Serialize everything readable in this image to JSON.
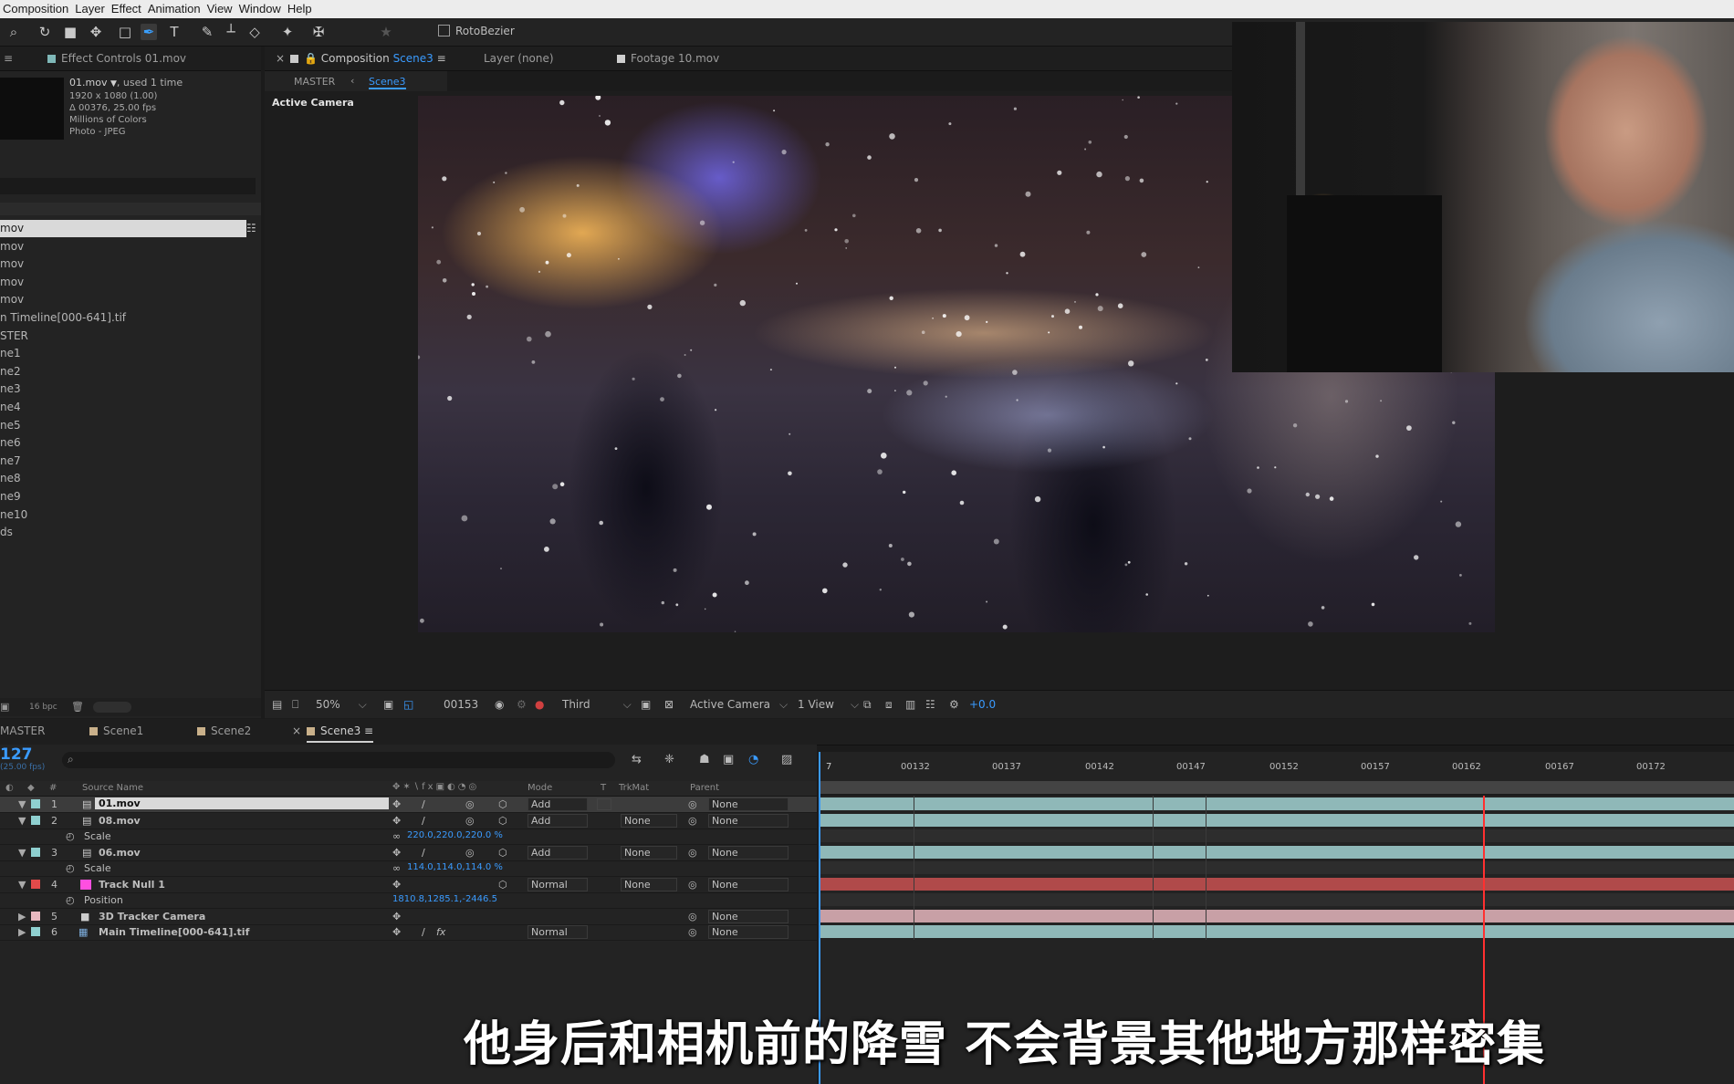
{
  "menu": [
    "Composition",
    "Layer",
    "Effect",
    "Animation",
    "View",
    "Window",
    "Help"
  ],
  "toolbar": {
    "rotobezier": "RotoBezier"
  },
  "effect_controls": {
    "tab": "Effect Controls 01.mov",
    "file_name": "01.mov",
    "used": ", used 1 time",
    "info": [
      "1920 x 1080 (1.00)",
      "Δ 00376, 25.00 fps",
      "Millions of Colors",
      "Photo - JPEG"
    ]
  },
  "project_items": [
    "mov",
    "mov",
    "mov",
    "mov",
    "mov",
    "n Timeline[000-641].tif",
    "STER",
    "ne1",
    "ne2",
    "ne3",
    "ne4",
    "ne5",
    "ne6",
    "ne7",
    "ne8",
    "ne9",
    "ne10",
    "ds"
  ],
  "project_footer": {
    "bpc": "16 bpc"
  },
  "viewer_tabs": {
    "composition_prefix": "Composition",
    "composition_name": "Scene3",
    "layer": "Layer (none)",
    "footage": "Footage 10.mov"
  },
  "breadcrumb": {
    "master": "MASTER",
    "scene": "Scene3"
  },
  "viewer": {
    "active_camera_label": "Active Camera"
  },
  "viewer_bar": {
    "zoom": "50%",
    "frame": "00153",
    "resolution": "Third",
    "camera": "Active Camera",
    "views": "1 View",
    "exposure": "+0.0"
  },
  "timeline_tabs": [
    "MASTER",
    "Scene1",
    "Scene2",
    "Scene3"
  ],
  "timeline": {
    "timecode": "127",
    "fps": "(25.00 fps)",
    "columns": {
      "num": "#",
      "source_name": "Source Name",
      "mode": "Mode",
      "t": "T",
      "trkmat": "TrkMat",
      "parent": "Parent"
    },
    "ruler": [
      "00132",
      "00137",
      "00142",
      "00147",
      "00152",
      "00157",
      "00162",
      "00167",
      "00172"
    ],
    "ruler_first": "7",
    "layers": [
      {
        "num": "1",
        "name": "01.mov",
        "mode": "Add",
        "trkmat": "",
        "parent": "None",
        "color": "#8fd0d0"
      },
      {
        "num": "2",
        "name": "08.mov",
        "mode": "Add",
        "trkmat": "None",
        "parent": "None",
        "color": "#8fd0d0"
      },
      {
        "prop": "Scale",
        "value": "220.0,220.0,220.0 %"
      },
      {
        "num": "3",
        "name": "06.mov",
        "mode": "Add",
        "trkmat": "None",
        "parent": "None",
        "color": "#8fd0d0"
      },
      {
        "prop": "Scale",
        "value": "114.0,114.0,114.0 %"
      },
      {
        "num": "4",
        "name": "Track Null 1",
        "mode": "Normal",
        "trkmat": "None",
        "parent": "None",
        "color": "#e34a4a"
      },
      {
        "prop": "Position",
        "value": "1810.8,1285.1,-2446.5"
      },
      {
        "num": "5",
        "name": "3D Tracker Camera",
        "mode": "",
        "trkmat": "",
        "parent": "None",
        "color": "#e8b8c0"
      },
      {
        "num": "6",
        "name": "Main Timeline[000-641].tif",
        "mode": "Normal",
        "trkmat": "",
        "parent": "None",
        "color": "#8fd0d0"
      }
    ]
  },
  "subtitle": "他身后和相机前的降雪   不会背景其他地方那样密集",
  "colors": {
    "accent": "#3a9bff",
    "cti": "#ff3030",
    "teal_bar": "#8fb8b8",
    "red_bar": "#b04a4a",
    "pink_bar": "#c8a0a6"
  }
}
